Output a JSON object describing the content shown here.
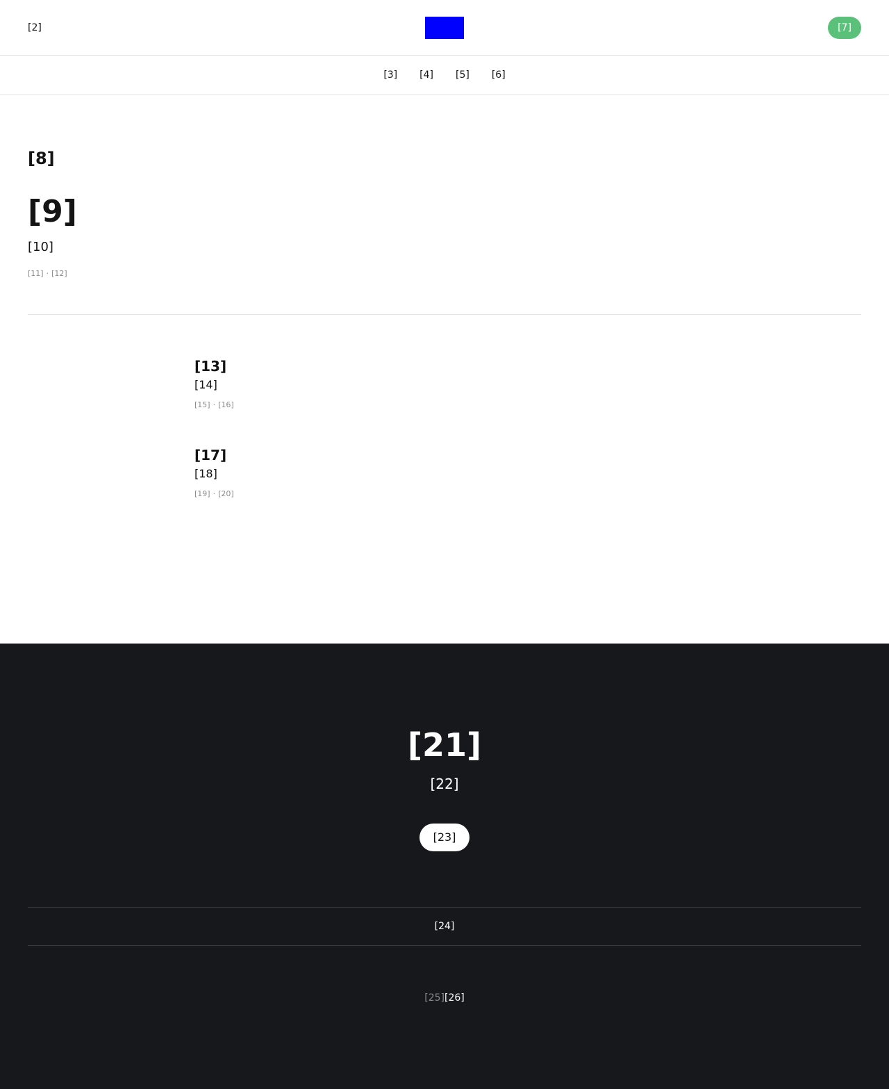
{
  "header": {
    "menu_label": "[2]",
    "cta_label": "[7]",
    "brand_color": "#0000ff",
    "cta_color": "#5ac07a"
  },
  "nav": {
    "items": [
      {
        "label": "[3]"
      },
      {
        "label": "[4]"
      },
      {
        "label": "[5]"
      },
      {
        "label": "[6]"
      }
    ]
  },
  "hero": {
    "kicker": "[8]",
    "title": "[9]",
    "subtitle": "[10]",
    "meta_a": "[11]",
    "meta_b": "[12]",
    "meta_separator": "·"
  },
  "articles": [
    {
      "title": "[13]",
      "excerpt": "[14]",
      "meta_a": "[15]",
      "meta_b": "[16]"
    },
    {
      "title": "[17]",
      "excerpt": "[18]",
      "meta_a": "[19]",
      "meta_b": "[20]"
    }
  ],
  "footer": {
    "title": "[21]",
    "subtitle": "[22]",
    "button_label": "[23]",
    "link_label": "[24]",
    "credit_prefix": "[25]",
    "credit_name": "[26]",
    "background_color": "#17181c"
  }
}
